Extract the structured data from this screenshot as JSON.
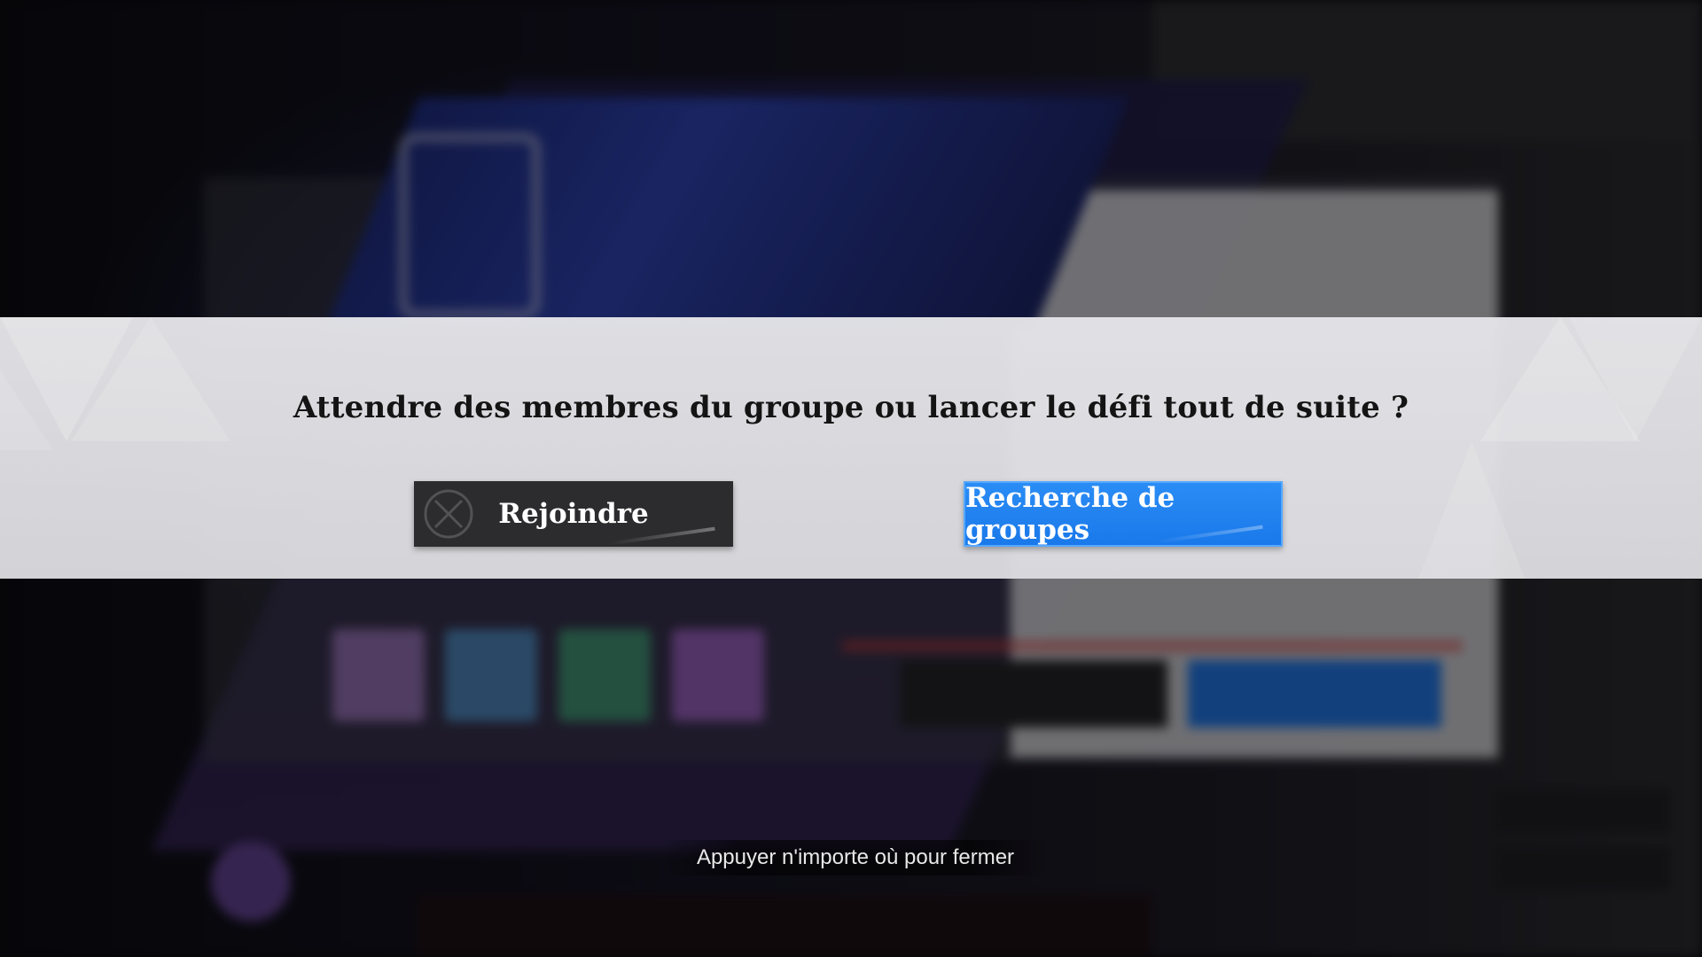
{
  "dialog": {
    "question": "Attendre des membres du groupe ou lancer le défi tout de suite ?",
    "join_label": "Rejoindre",
    "search_label": "Recherche de groupes"
  },
  "close_hint": "Appuyer n'importe où pour fermer",
  "colors": {
    "accent_blue": "#1a79ea",
    "dark_button": "#2c2c2e",
    "modal_band": "#e4e4e8"
  }
}
